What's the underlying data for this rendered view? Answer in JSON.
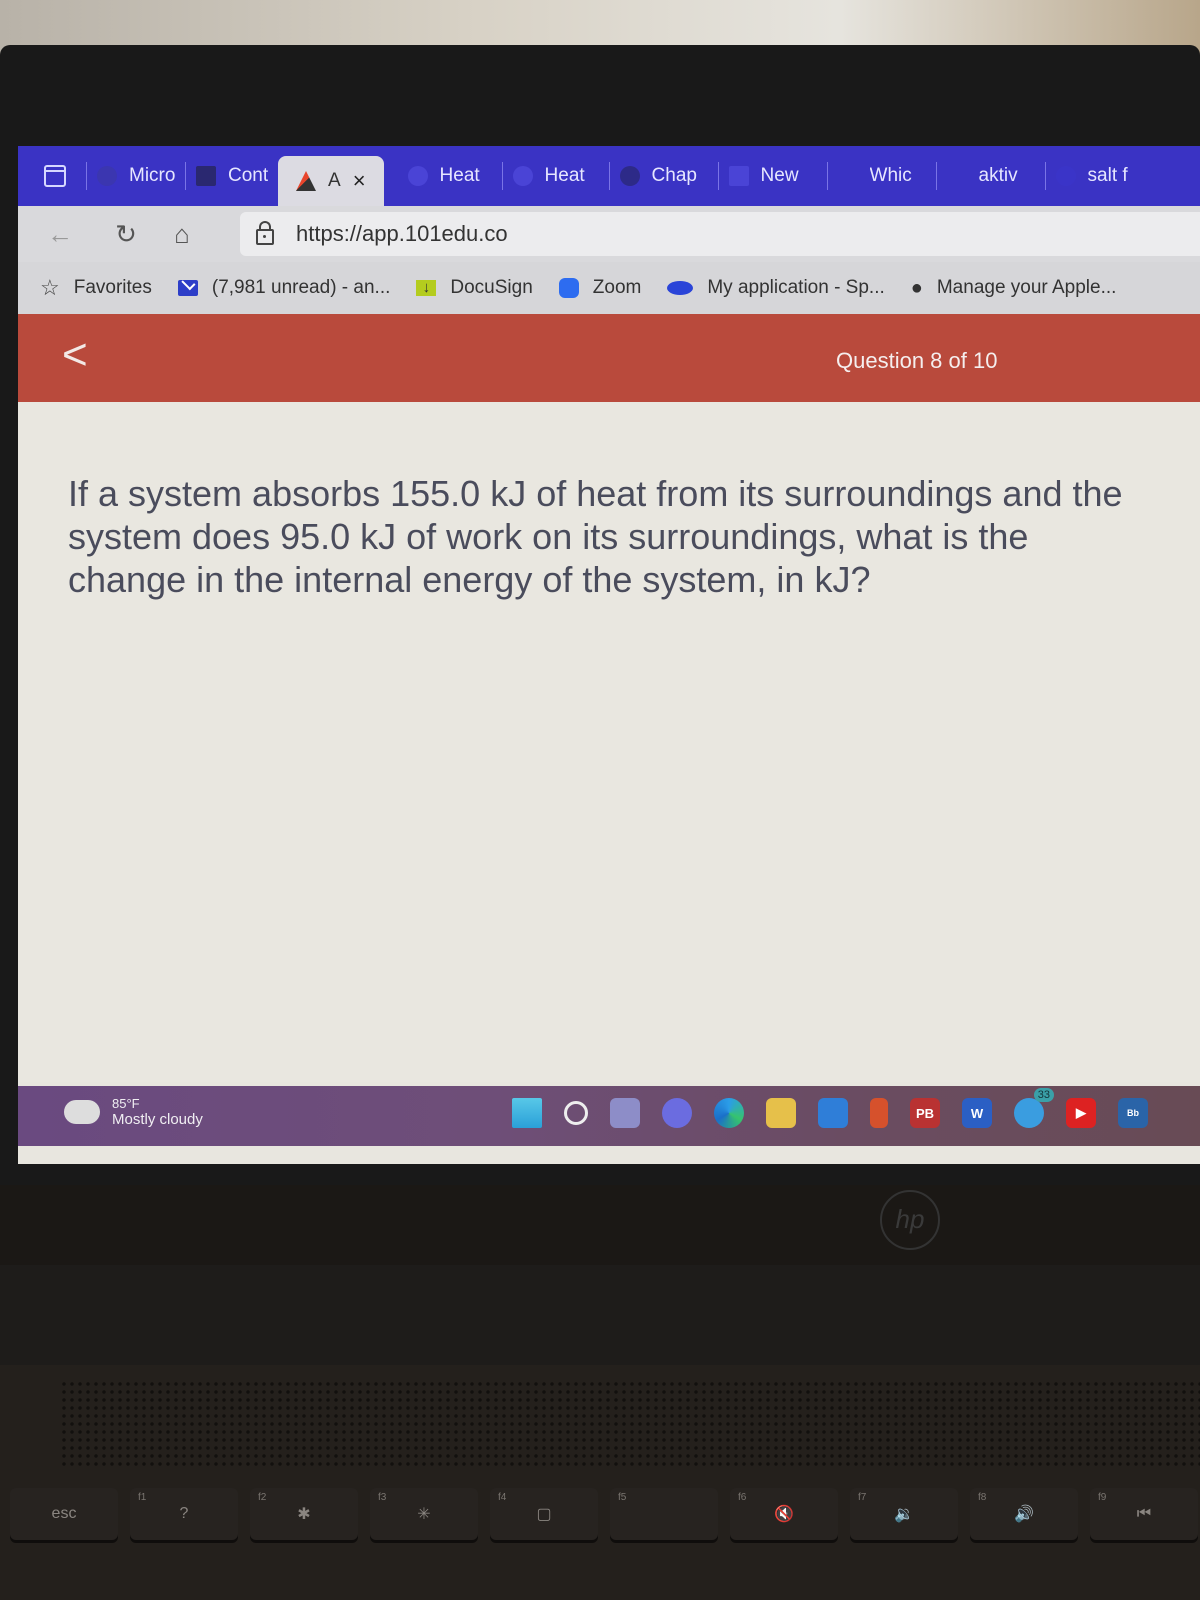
{
  "browser": {
    "tabs": [
      {
        "label": "Micro",
        "icon": "app-icon",
        "active": false
      },
      {
        "label": "Cont",
        "icon": "edit-icon",
        "active": false
      },
      {
        "label": "A",
        "icon": "101edu-logo-icon",
        "active": true,
        "close": "×"
      },
      {
        "label": "Heat",
        "icon": "site-icon",
        "active": false
      },
      {
        "label": "Heat",
        "icon": "site-icon",
        "active": false
      },
      {
        "label": "Chap",
        "icon": "puzzle-icon",
        "active": false
      },
      {
        "label": "New",
        "icon": "page-icon",
        "active": false
      },
      {
        "label": "Whic",
        "icon": "site-icon",
        "active": false
      },
      {
        "label": "aktiv",
        "icon": "site-icon",
        "active": false
      },
      {
        "label": "salt f",
        "icon": "site-icon",
        "active": false
      }
    ],
    "nav": {
      "back": "←",
      "refresh": "↻",
      "home": "⌂"
    },
    "url": "https://app.101edu.co",
    "favorites": [
      {
        "label": "Favorites",
        "icon": "star-list-icon"
      },
      {
        "label": "(7,981 unread) - an...",
        "icon": "mail-icon"
      },
      {
        "label": "DocuSign",
        "icon": "docusign-icon"
      },
      {
        "label": "Zoom",
        "icon": "zoom-icon"
      },
      {
        "label": "My application - Sp...",
        "icon": "salesforce-icon"
      },
      {
        "label": "Manage your Apple...",
        "icon": "apple-icon"
      }
    ]
  },
  "quiz": {
    "back_glyph": "<",
    "progress": "Question 8 of 10",
    "question_current": 8,
    "question_total": 10,
    "question_text": "If a system absorbs 155.0 kJ of heat from its surroundings and the system does 95.0 kJ of work on its surroundings, what is the change in the internal energy of the system, in kJ?"
  },
  "taskbar": {
    "weather": {
      "temp": "85°F",
      "condition": "Mostly cloudy"
    },
    "icons": [
      {
        "name": "start",
        "label": ""
      },
      {
        "name": "search",
        "label": ""
      },
      {
        "name": "task-view",
        "label": ""
      },
      {
        "name": "chat",
        "label": ""
      },
      {
        "name": "edge",
        "label": ""
      },
      {
        "name": "file-explorer",
        "label": ""
      },
      {
        "name": "mail",
        "label": ""
      },
      {
        "name": "office",
        "label": ""
      },
      {
        "name": "publisher",
        "label": "PB"
      },
      {
        "name": "word",
        "label": "W"
      },
      {
        "name": "twitter",
        "label": "",
        "badge": "33"
      },
      {
        "name": "youtube",
        "label": "▶"
      },
      {
        "name": "blackboard",
        "label": "Bb"
      }
    ]
  },
  "laptop": {
    "brand": "hp",
    "keys": [
      {
        "fn": "",
        "label": "esc"
      },
      {
        "fn": "f1",
        "label": "?"
      },
      {
        "fn": "f2",
        "label": "✱"
      },
      {
        "fn": "f3",
        "label": "✳"
      },
      {
        "fn": "f4",
        "label": "▢"
      },
      {
        "fn": "f5",
        "label": ""
      },
      {
        "fn": "f6",
        "label": "🔇"
      },
      {
        "fn": "f7",
        "label": "🔉"
      },
      {
        "fn": "f8",
        "label": "🔊"
      },
      {
        "fn": "f9",
        "label": "⏮"
      }
    ]
  },
  "colors": {
    "tabstrip": "#3a33c4",
    "header_red": "#b94a3c",
    "question_text": "#4a4c5c",
    "taskbar": "#6a4a80"
  }
}
